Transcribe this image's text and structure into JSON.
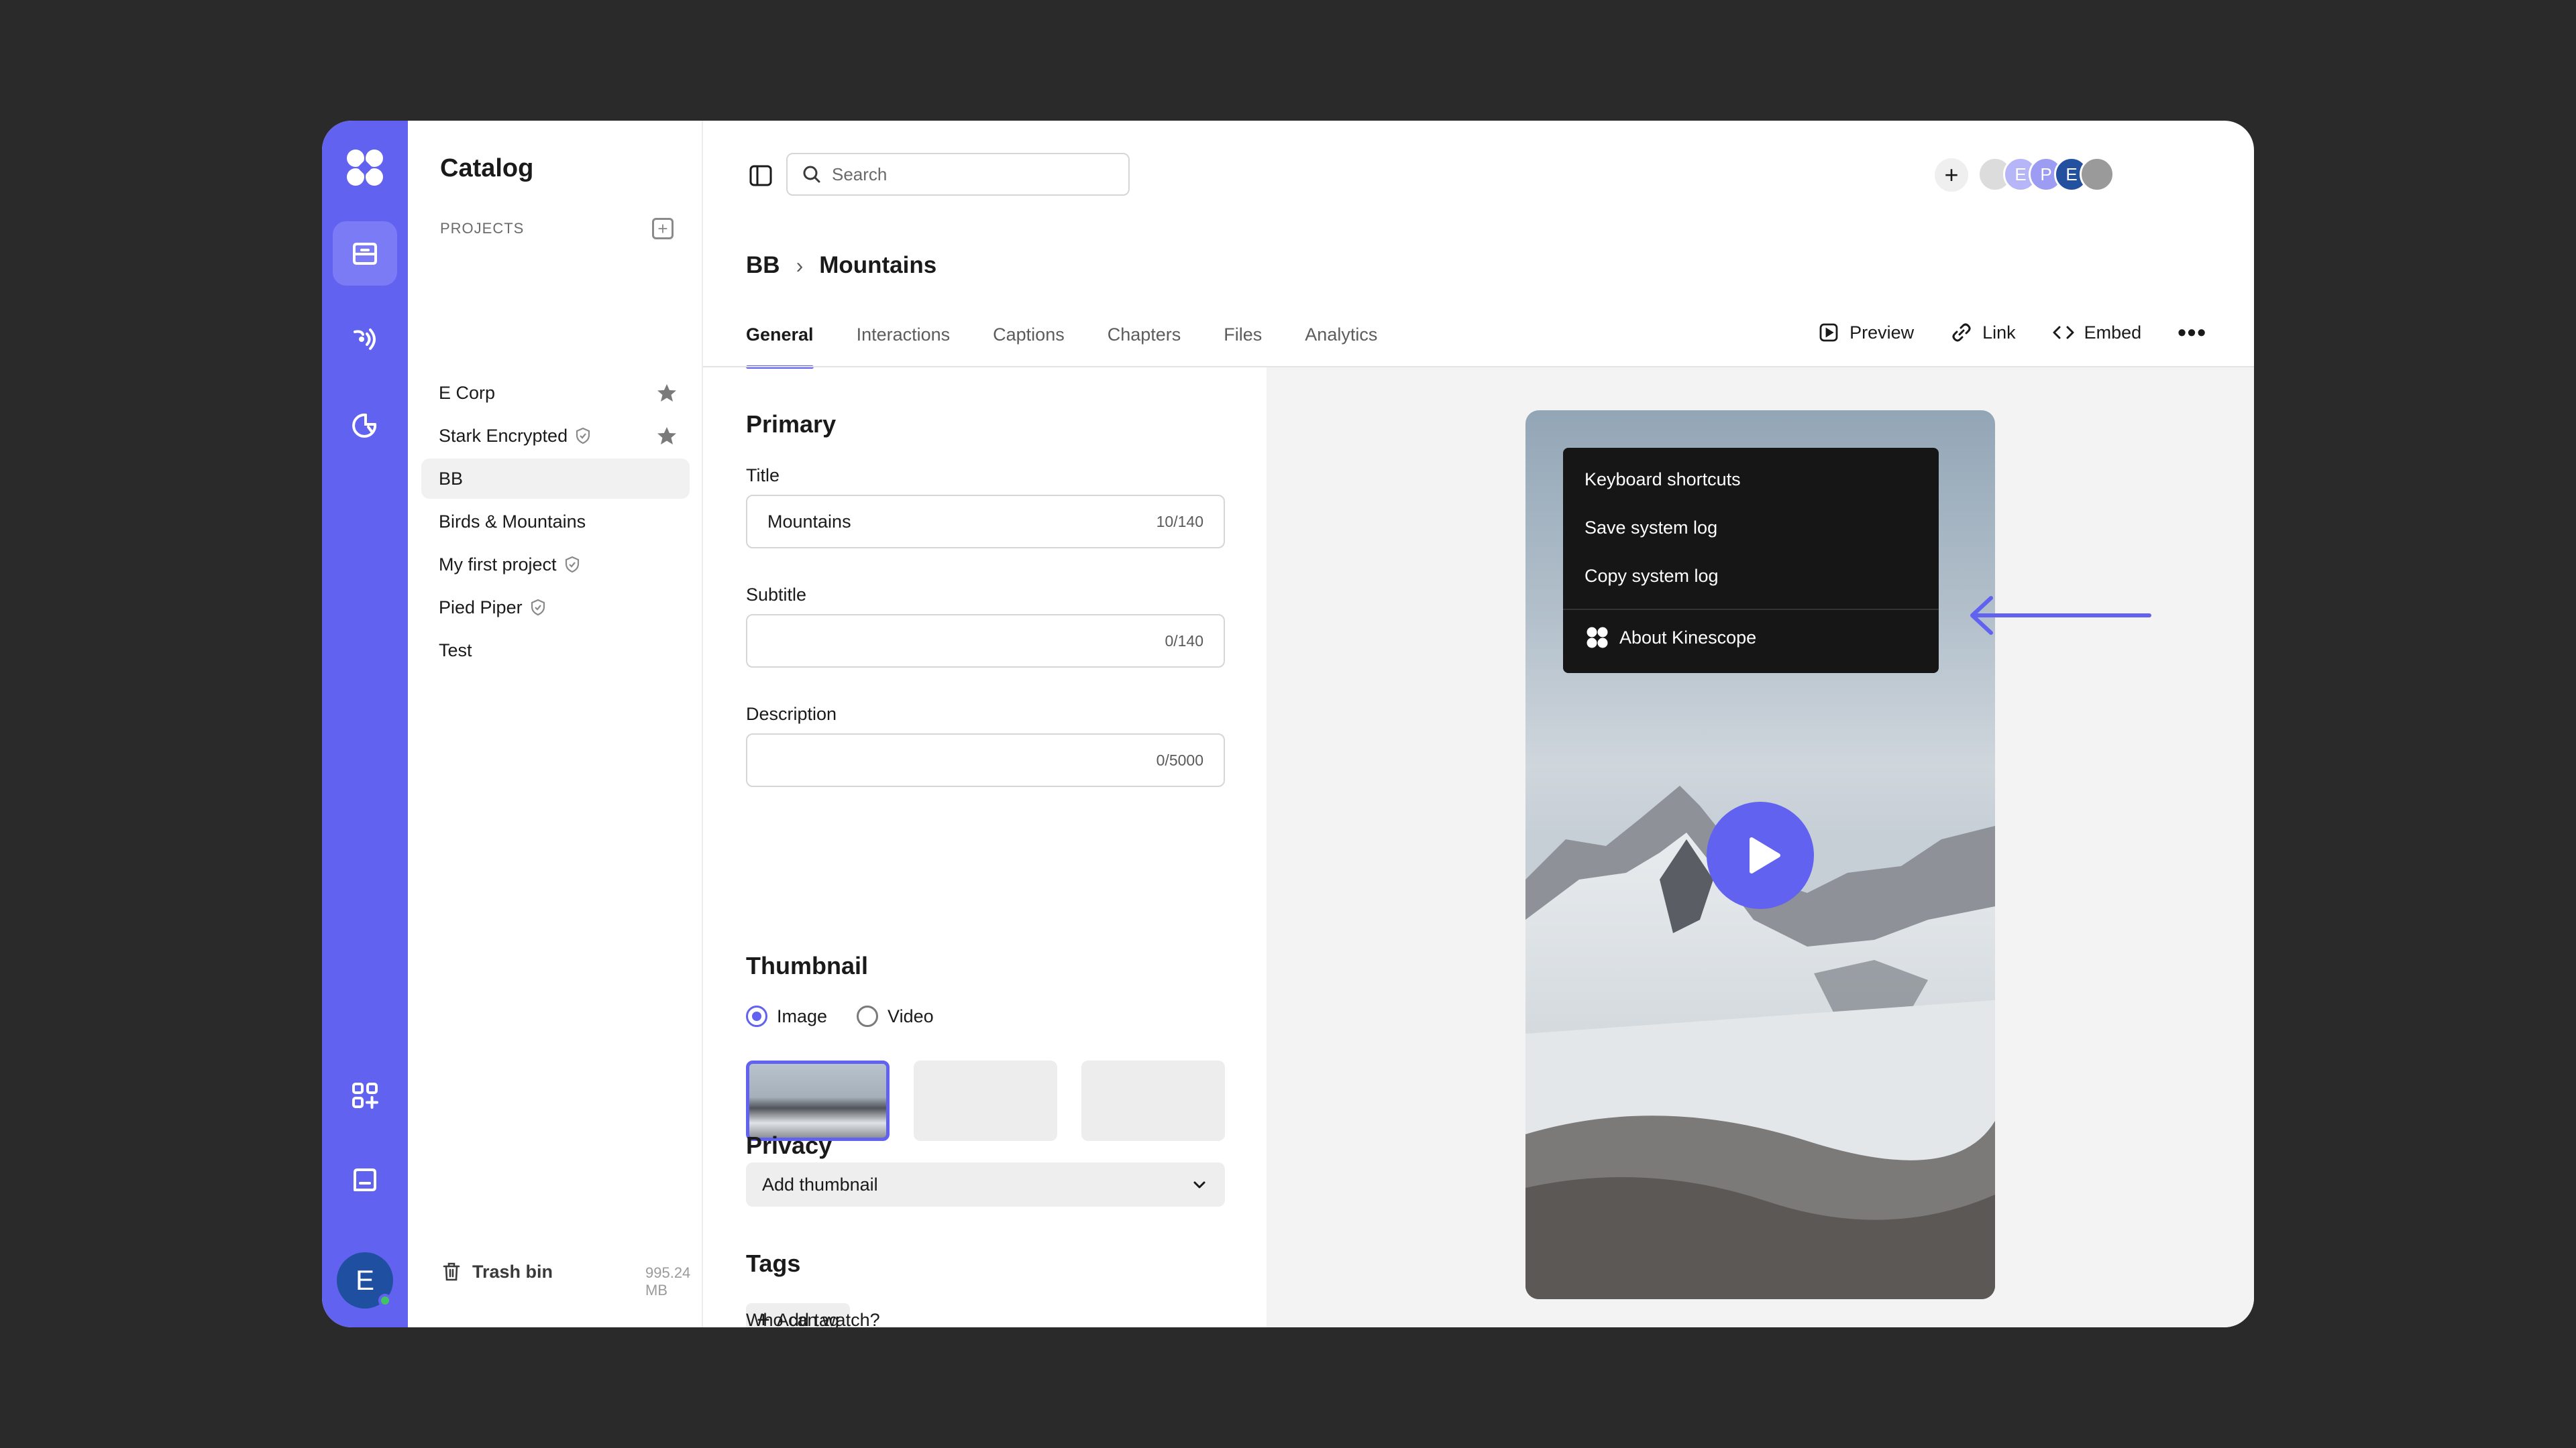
{
  "sidebar": {
    "title": "Catalog",
    "section_label": "PROJECTS",
    "items": [
      {
        "label": "E Corp",
        "starred": true,
        "shield": false
      },
      {
        "label": "Stark Encrypted",
        "starred": true,
        "shield": true
      },
      {
        "label": "BB",
        "starred": false,
        "shield": false,
        "active": true
      },
      {
        "label": "Birds & Mountains",
        "starred": false,
        "shield": false
      },
      {
        "label": "My first project",
        "starred": false,
        "shield": true
      },
      {
        "label": "Pied Piper",
        "starred": false,
        "shield": true
      },
      {
        "label": "Test",
        "starred": false,
        "shield": false
      }
    ],
    "trash_label": "Trash bin",
    "trash_size": "995.24 MB"
  },
  "rail": {
    "user_initial": "E",
    "accent": "#6262f0"
  },
  "header": {
    "search_placeholder": "Search",
    "avatars": [
      "",
      "E",
      "P",
      "E",
      ""
    ]
  },
  "breadcrumb": {
    "parent": "BB",
    "current": "Mountains"
  },
  "tabs": [
    "General",
    "Interactions",
    "Captions",
    "Chapters",
    "Files",
    "Analytics"
  ],
  "actions": {
    "preview": "Preview",
    "link": "Link",
    "embed": "Embed"
  },
  "form": {
    "primary_heading": "Primary",
    "title_label": "Title",
    "title_value": "Mountains",
    "title_counter": "10/140",
    "subtitle_label": "Subtitle",
    "subtitle_value": "",
    "subtitle_counter": "0/140",
    "description_label": "Description",
    "description_value": "",
    "description_counter": "0/5000",
    "thumbnail_heading": "Thumbnail",
    "radio_image": "Image",
    "radio_video": "Video",
    "add_thumbnail": "Add thumbnail",
    "tags_heading": "Tags",
    "add_tag": "Add tag",
    "privacy_heading": "Privacy",
    "who_can_watch": "Who can watch?"
  },
  "player_menu": {
    "items": [
      "Keyboard shortcuts",
      "Save system log",
      "Copy system log"
    ],
    "about": "About Kinescope"
  }
}
